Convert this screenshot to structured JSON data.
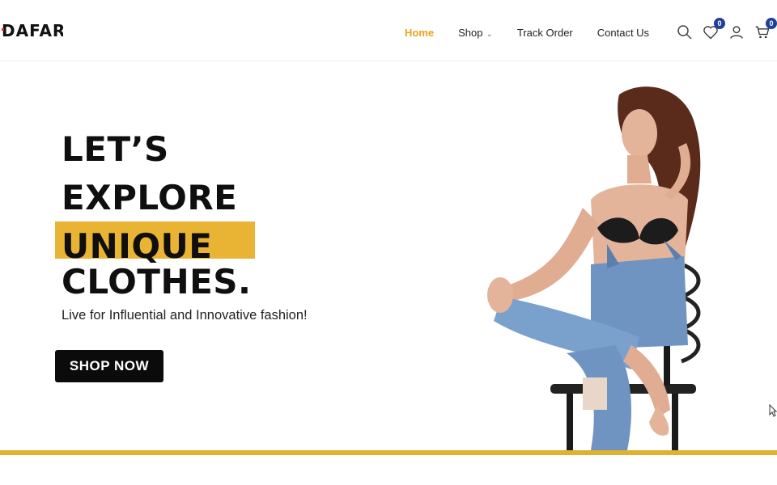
{
  "brand": {
    "logo_text": "DAFAR",
    "accent_color": "#e0222e"
  },
  "nav": {
    "items": [
      {
        "label": "Home",
        "active": true
      },
      {
        "label": "Shop",
        "has_dropdown": true
      },
      {
        "label": "Track Order"
      },
      {
        "label": "Contact Us"
      }
    ],
    "active_color": "#e5a61d"
  },
  "header_icons": {
    "search": "search-icon",
    "wishlist": "heart-icon",
    "wishlist_count": "0",
    "account": "user-icon",
    "cart": "cart-icon",
    "cart_count": "0",
    "badge_color": "#1f3f9a"
  },
  "hero": {
    "line1": "LET’S",
    "line2": "EXPLORE",
    "line3": "UNIQUE",
    "line4": "CLOTHES.",
    "highlight_color": "#e9b433",
    "subtitle": "Live for Influential and Innovative fashion!",
    "cta_label": "SHOP NOW"
  },
  "colors": {
    "bottom_bar": "#e0b030"
  }
}
